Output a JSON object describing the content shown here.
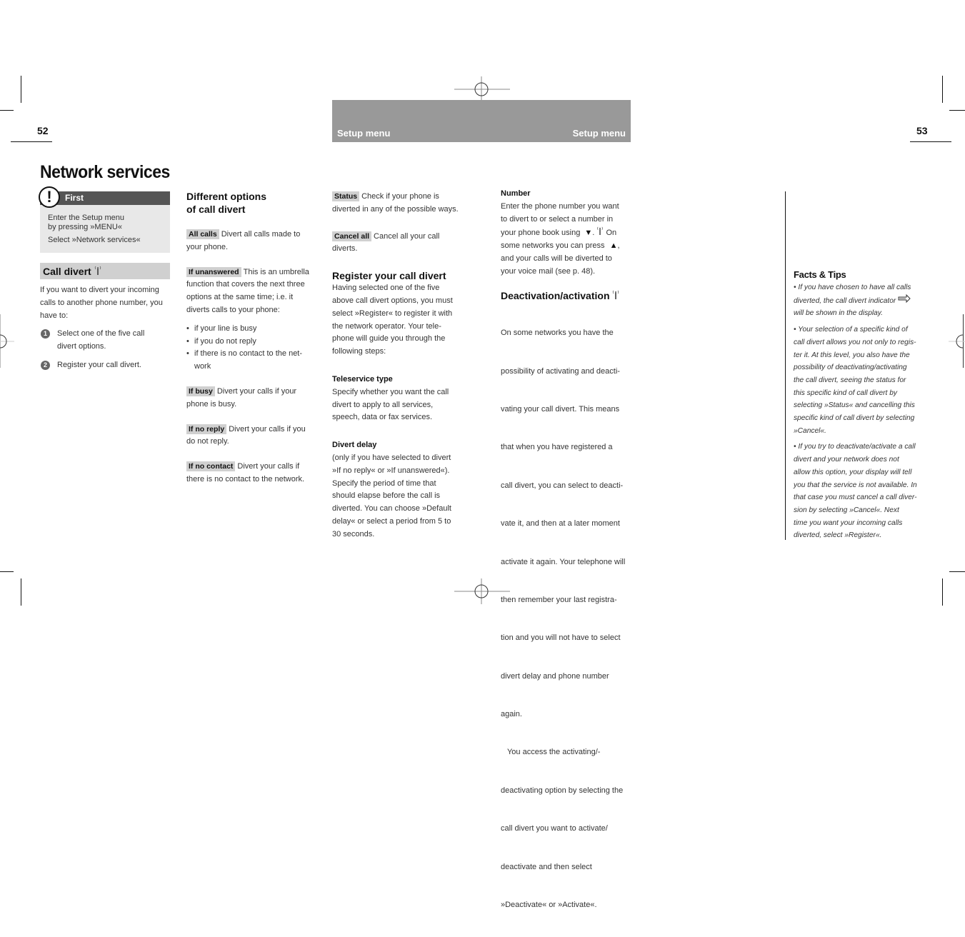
{
  "page_numbers": {
    "left": "52",
    "right": "53"
  },
  "header": {
    "left_label": "Setup menu",
    "right_label": "Setup menu"
  },
  "title": "Network services",
  "first_box": {
    "heading": "First",
    "icon": "exclamation-icon",
    "lines": [
      "Enter the Setup menu",
      "by pressing »MENU«",
      "Select »Network services«"
    ]
  },
  "call_divert": {
    "heading": "Call divert",
    "icon": "antenna-icon",
    "intro": [
      "If you want to divert your incoming",
      "calls to another phone number, you",
      "have to:"
    ],
    "steps": [
      {
        "num": "1",
        "lines": [
          "Select one of the five call",
          "divert options."
        ]
      },
      {
        "num": "2",
        "lines": [
          "Register your call divert."
        ]
      }
    ]
  },
  "options": {
    "heading_lines": [
      "Different options",
      "of call divert"
    ],
    "items": [
      {
        "tag": "All calls",
        "first": "Divert all calls made to",
        "rest": [
          "your phone."
        ]
      },
      {
        "tag": "If unanswered",
        "first": "This is an umbrella",
        "rest": [
          "function that covers the next three",
          "options at the same time; i.e. it",
          "diverts calls to your phone:"
        ]
      }
    ],
    "bullets": [
      "if your line is busy",
      "if you do not reply",
      "if there is no contact to the net-",
      "work"
    ],
    "items2": [
      {
        "tag": "If busy",
        "first": "Divert your calls if your",
        "rest": [
          "phone is busy."
        ]
      },
      {
        "tag": "If no reply",
        "first": "Divert your calls if you",
        "rest": [
          "do not reply."
        ]
      },
      {
        "tag": "If no contact",
        "first": "Divert your calls if",
        "rest": [
          "there is no contact to the network."
        ]
      }
    ]
  },
  "col3": {
    "items": [
      {
        "tag": "Status",
        "first": "Check if your phone is",
        "rest": [
          "diverted in any of the possible ways."
        ]
      },
      {
        "tag": "Cancel all",
        "first": "Cancel all your call",
        "rest": [
          "diverts."
        ]
      }
    ],
    "register": {
      "heading": "Register your call divert",
      "lines": [
        "Having selected one of the five",
        "above call divert options, you must",
        "select »Register« to register it with",
        "the network operator. Your tele-",
        "phone will guide you through the",
        "following steps:"
      ]
    },
    "teleservice": {
      "heading": "Teleservice type",
      "lines": [
        "Specify whether you want the call",
        "divert to apply to all services,",
        "speech, data or fax services."
      ]
    },
    "divert_delay": {
      "heading": "Divert delay",
      "lines": [
        "(only if you have selected to divert",
        "»If no reply« or »If unanswered«).",
        "Specify the period of time that",
        "should elapse before the call is",
        "diverted. You can choose »Default",
        "delay« or select a period from 5 to",
        "30 seconds."
      ]
    }
  },
  "col4": {
    "number": {
      "heading": "Number",
      "lines": [
        "Enter the phone number you want",
        "to divert to or select a number in"
      ],
      "line3_pre": "your phone book using",
      "down_arrow": "▼",
      "line3_post": "On",
      "line4_pre": "some networks you can press",
      "up_arrow": "▲",
      "line4_post": ",",
      "lines_end": [
        "and your calls will be diverted to",
        "your voice mail (see p. 48)."
      ]
    },
    "deactivation": {
      "heading": "Deactivation/activation",
      "lines": [
        "On some networks you have the",
        "possibility of activating and deacti-",
        "vating your call divert. This means",
        "that when you have registered a",
        "call divert, you can select to deacti-",
        "vate it, and then at a later moment",
        "activate it again. Your telephone will",
        "then remember your last registra-",
        "tion and you will not have to select",
        "divert delay and phone number",
        "again.",
        "   You access the activating/-",
        "deactivating option by selecting the",
        "call divert you want to activate/",
        "deactivate and then select",
        "»Deactivate« or »Activate«."
      ]
    }
  },
  "facts": {
    "heading": "Facts & Tips",
    "tip1": [
      "• If you have chosen to have all calls",
      "diverted, the call divert indicator",
      "will be shown in the display."
    ],
    "tip2": [
      "• Your selection of a specific kind of",
      "call divert allows you not only to regis-",
      "ter it. At this level, you also have the",
      "possibility of deactivating/activating",
      "the call divert, seeing the status for",
      "this specific kind of call divert by",
      "selecting »Status« and cancelling this",
      "specific kind of call divert by selecting",
      "»Cancel«."
    ],
    "tip3": [
      "• If you try to deactivate/activate a call",
      "divert and your network does not",
      "allow this option, your display will tell",
      "you that the service is not available. In",
      "that case you must cancel a call diver-",
      "sion by selecting »Cancel«. Next",
      "time you want your incoming calls",
      "diverted, select »Register«."
    ]
  }
}
